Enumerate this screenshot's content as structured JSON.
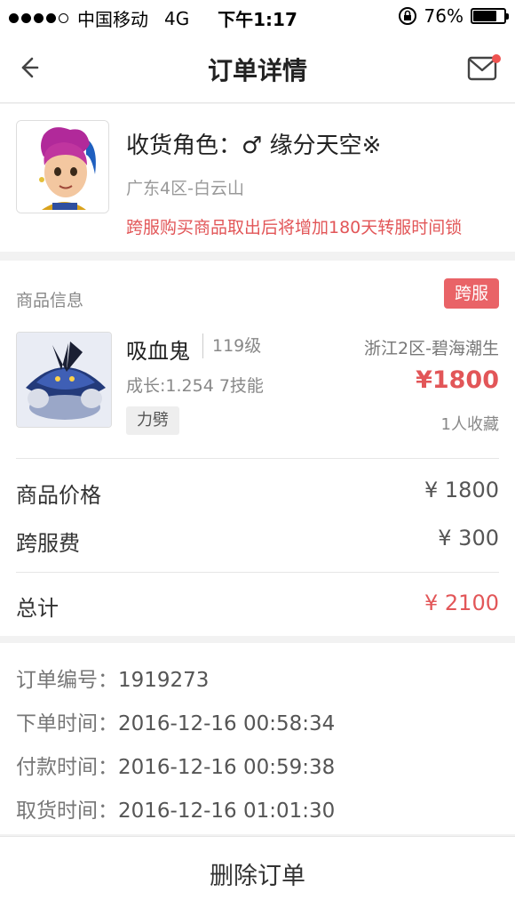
{
  "status_bar": {
    "carrier": "中国移动",
    "network": "4G",
    "time": "下午1:17",
    "battery": "76%",
    "battery_level": 0.76
  },
  "header": {
    "title": "订单详情",
    "back_icon": "back-arrow-icon",
    "mail_icon": "mail-icon"
  },
  "role": {
    "name": "收货角色：♂ 缘分天空※",
    "server": "广东4区-白云山",
    "warning": "跨服购买商品取出后将增加180天转服时间锁"
  },
  "product": {
    "section_label": "商品信息",
    "tag": "跨服",
    "pet_name": "吸血鬼",
    "level": "119级",
    "zone": "浙江2区-碧海潮生",
    "stats": "成长:1.254 7技能",
    "price": "¥1800",
    "skill": "力劈",
    "favorites": "1人收藏"
  },
  "fees": {
    "goods_price_label": "商品价格",
    "goods_price_value": "¥ 1800",
    "cross_fee_label": "跨服费",
    "cross_fee_value": "¥ 300",
    "total_label": "总计",
    "total_value": "¥ 2100"
  },
  "order": {
    "number_label": "订单编号：",
    "number": "1919273",
    "order_time_label": "下单时间：",
    "order_time": "2016-12-16 00:58:34",
    "pay_time_label": "付款时间：",
    "pay_time": "2016-12-16 00:59:38",
    "pickup_time_label": "取货时间：",
    "pickup_time": "2016-12-16 01:01:30"
  },
  "actions": {
    "delete": "删除订单"
  },
  "colors": {
    "accent": "#e25658",
    "tag_bg": "#e96367",
    "notification_dot": "#ef5350"
  }
}
